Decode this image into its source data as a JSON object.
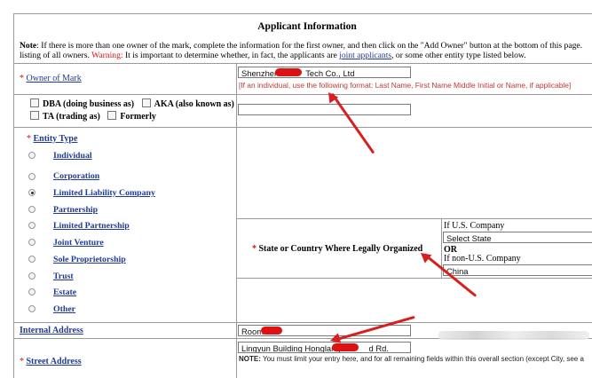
{
  "header": {
    "title": "Applicant Information"
  },
  "note": {
    "prefix": "Note",
    "text1": ": If there is more than one owner of the mark, complete the information for the first owner, and then click on the \"Add Owner\" button at the bottom of this page.",
    "text2": "listing of all owners.",
    "warning_label": "Warning:",
    "text3": " It is important to determine whether, in fact, the applicants are ",
    "link": "joint applicants",
    "text4": ", or some other entity type listed below."
  },
  "owner": {
    "required_mark": "*",
    "label": "Owner of Mark",
    "value_start": "Shenzhen",
    "value_end": "Tech Co., Ltd",
    "hint": "[If an individual, use the following format: Last Name, First Name Middle Initial or Name, if applicable]"
  },
  "dba": {
    "dba_label": "DBA (doing business as)",
    "aka_label": "AKA (also known as)",
    "ta_label": "TA (trading as)",
    "formerly_label": "Formerly"
  },
  "entity": {
    "required_mark": "*",
    "label": "Entity Type",
    "options": [
      "Individual",
      "Corporation",
      "Limited Liability Company",
      "Partnership",
      "Limited Partnership",
      "Joint Venture",
      "Sole Proprietorship",
      "Trust",
      "Estate",
      "Other"
    ],
    "selected": "Limited Liability Company"
  },
  "state": {
    "required_mark": "*",
    "label": "State or Country Where Legally Organized",
    "us_label": "If U.S. Company",
    "select_value": "Select State",
    "or_label": "OR",
    "non_us_label": "If non-U.S. Company",
    "country_value": "China"
  },
  "internal_address": {
    "label": "Internal Address",
    "value": "Room"
  },
  "street_address": {
    "required_mark": "*",
    "label": "Street Address",
    "value_start": "Lingyun Building Honglang",
    "value_end": "d Rd.",
    "note_prefix": "NOTE:",
    "note_text": " You must limit your entry here, and for all remaining fields within this overall section (except City, see a"
  }
}
